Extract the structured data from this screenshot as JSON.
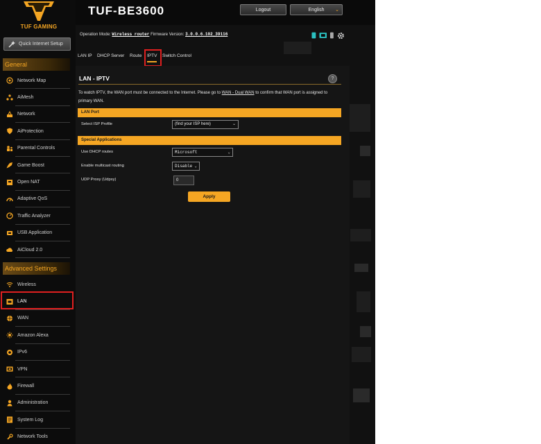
{
  "brand": {
    "name": "TUF GAMING"
  },
  "quick_setup": {
    "label": "Quick Internet Setup"
  },
  "sidebar": {
    "general_title": "General",
    "general_items": [
      {
        "label": "Network Map",
        "icon": "network-map-icon"
      },
      {
        "label": "AiMesh",
        "icon": "aimesh-icon"
      },
      {
        "label": "Network",
        "icon": "network-icon"
      },
      {
        "label": "AiProtection",
        "icon": "shield-icon"
      },
      {
        "label": "Parental Controls",
        "icon": "parental-icon"
      },
      {
        "label": "Game Boost",
        "icon": "rocket-icon"
      },
      {
        "label": "Open NAT",
        "icon": "nat-icon"
      },
      {
        "label": "Adaptive QoS",
        "icon": "qos-icon"
      },
      {
        "label": "Traffic Analyzer",
        "icon": "traffic-icon"
      },
      {
        "label": "USB Application",
        "icon": "usb-icon"
      },
      {
        "label": "AiCloud 2.0",
        "icon": "cloud-icon"
      }
    ],
    "advanced_title": "Advanced Settings",
    "advanced_items": [
      {
        "label": "Wireless",
        "icon": "wireless-icon"
      },
      {
        "label": "LAN",
        "icon": "lan-icon",
        "active": true
      },
      {
        "label": "WAN",
        "icon": "wan-icon"
      },
      {
        "label": "Amazon Alexa",
        "icon": "alexa-icon"
      },
      {
        "label": "IPv6",
        "icon": "ipv6-icon"
      },
      {
        "label": "VPN",
        "icon": "vpn-icon"
      },
      {
        "label": "Firewall",
        "icon": "firewall-icon"
      },
      {
        "label": "Administration",
        "icon": "admin-icon"
      },
      {
        "label": "System Log",
        "icon": "log-icon"
      },
      {
        "label": "Network Tools",
        "icon": "tools-icon"
      }
    ]
  },
  "header": {
    "model": "TUF-BE3600",
    "logout_label": "Logout",
    "language": "English"
  },
  "status_line": {
    "mode_label": "Operation Mode:",
    "mode_value": "Wireless router",
    "fw_label": "Firmware Version:",
    "fw_value": "3.0.0.6.102_39116"
  },
  "tabs": [
    {
      "label": "LAN IP"
    },
    {
      "label": "DHCP Server"
    },
    {
      "label": "Route"
    },
    {
      "label": "IPTV",
      "selected": true
    },
    {
      "label": "Switch Control"
    }
  ],
  "panel": {
    "title": "LAN - IPTV",
    "desc_1": "To watch IPTV, the WAN port must be connected to the Internet. Please go to ",
    "desc_link": "WAN - Dual WAN",
    "desc_2": " to confirm that WAN port is assigned to primary WAN.",
    "lan_port_title": "LAN Port",
    "isp_profile_label": "Select ISP Profile",
    "isp_profile_value": "(find your ISP here)",
    "special_title": "Special Applications",
    "dhcp_routes_label": "Use DHCP routes",
    "dhcp_routes_value": "Microsoft",
    "multicast_label": "Enable multicast routing",
    "multicast_value": "Disable",
    "udpxy_label": "UDP Proxy (Udpxy)",
    "udpxy_value": "0",
    "apply_label": "Apply"
  },
  "colors": {
    "accent": "#f5a623",
    "highlight": "#e02020"
  }
}
